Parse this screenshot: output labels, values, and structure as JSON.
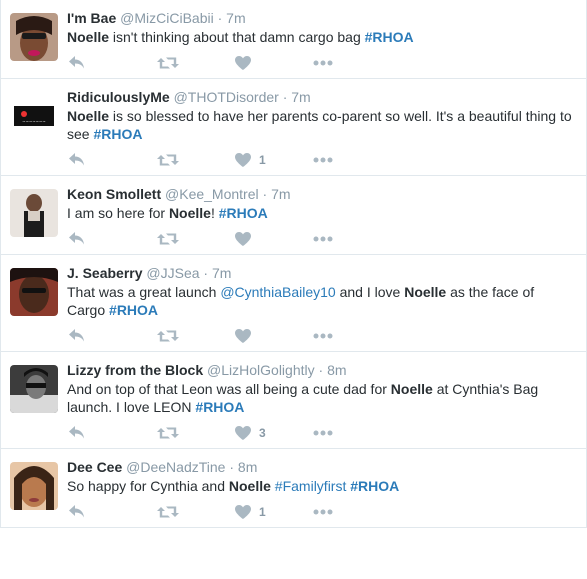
{
  "tweets": [
    {
      "fullname": "I'm Bae",
      "username": "@MizCiCiBabii",
      "time": "7m",
      "text": [
        {
          "t": "Noelle",
          "s": "b"
        },
        {
          "t": " isn't thinking about that damn cargo bag ",
          "s": "n"
        },
        {
          "t": "#RHOA",
          "s": "tag"
        }
      ],
      "likes": ""
    },
    {
      "fullname": "RidiculouslyMe",
      "username": "@THOTDisorder",
      "time": "7m",
      "text": [
        {
          "t": "Noelle",
          "s": "b"
        },
        {
          "t": " is so blessed to have her parents co-parent so well. It's a beautiful thing to see ",
          "s": "n"
        },
        {
          "t": "#RHOA",
          "s": "tag"
        }
      ],
      "likes": "1"
    },
    {
      "fullname": "Keon Smollett",
      "username": "@Kee_Montrel",
      "time": "7m",
      "text": [
        {
          "t": "I am so here for ",
          "s": "n"
        },
        {
          "t": "Noelle",
          "s": "b"
        },
        {
          "t": "! ",
          "s": "n"
        },
        {
          "t": "#RHOA",
          "s": "tag"
        }
      ],
      "likes": ""
    },
    {
      "fullname": "J. Seaberry",
      "username": "@JJSea",
      "time": "7m",
      "text": [
        {
          "t": "That was a great launch ",
          "s": "n"
        },
        {
          "t": "@CynthiaBailey10",
          "s": "link"
        },
        {
          "t": " and I love ",
          "s": "n"
        },
        {
          "t": "Noelle",
          "s": "b"
        },
        {
          "t": " as the face of Cargo ",
          "s": "n"
        },
        {
          "t": "#RHOA",
          "s": "tag"
        }
      ],
      "likes": ""
    },
    {
      "fullname": "Lizzy from the Block",
      "username": "@LizHolGolightly",
      "time": "8m",
      "text": [
        {
          "t": "And on top of that Leon was all being a cute dad for ",
          "s": "n"
        },
        {
          "t": "Noelle",
          "s": "b"
        },
        {
          "t": " at Cynthia's Bag launch. I love LEON ",
          "s": "n"
        },
        {
          "t": "#RHOA",
          "s": "tag"
        }
      ],
      "likes": "3"
    },
    {
      "fullname": "Dee Cee",
      "username": "@DeeNadzTine",
      "time": "8m",
      "text": [
        {
          "t": "So happy for Cynthia and ",
          "s": "n"
        },
        {
          "t": "Noelle",
          "s": "b"
        },
        {
          "t": " ",
          "s": "n"
        },
        {
          "t": "#Familyfirst",
          "s": "link"
        },
        {
          "t": " ",
          "s": "n"
        },
        {
          "t": "#RHOA",
          "s": "tag"
        }
      ],
      "likes": "1"
    }
  ],
  "separator": "·",
  "icons": {
    "reply": "reply-icon",
    "retweet": "retweet-icon",
    "like": "heart-icon",
    "more": "more-icon"
  },
  "colors": {
    "link": "#2b7bb9",
    "meta": "#8899a6",
    "icon": "#aab8c2",
    "text": "#292f33"
  }
}
